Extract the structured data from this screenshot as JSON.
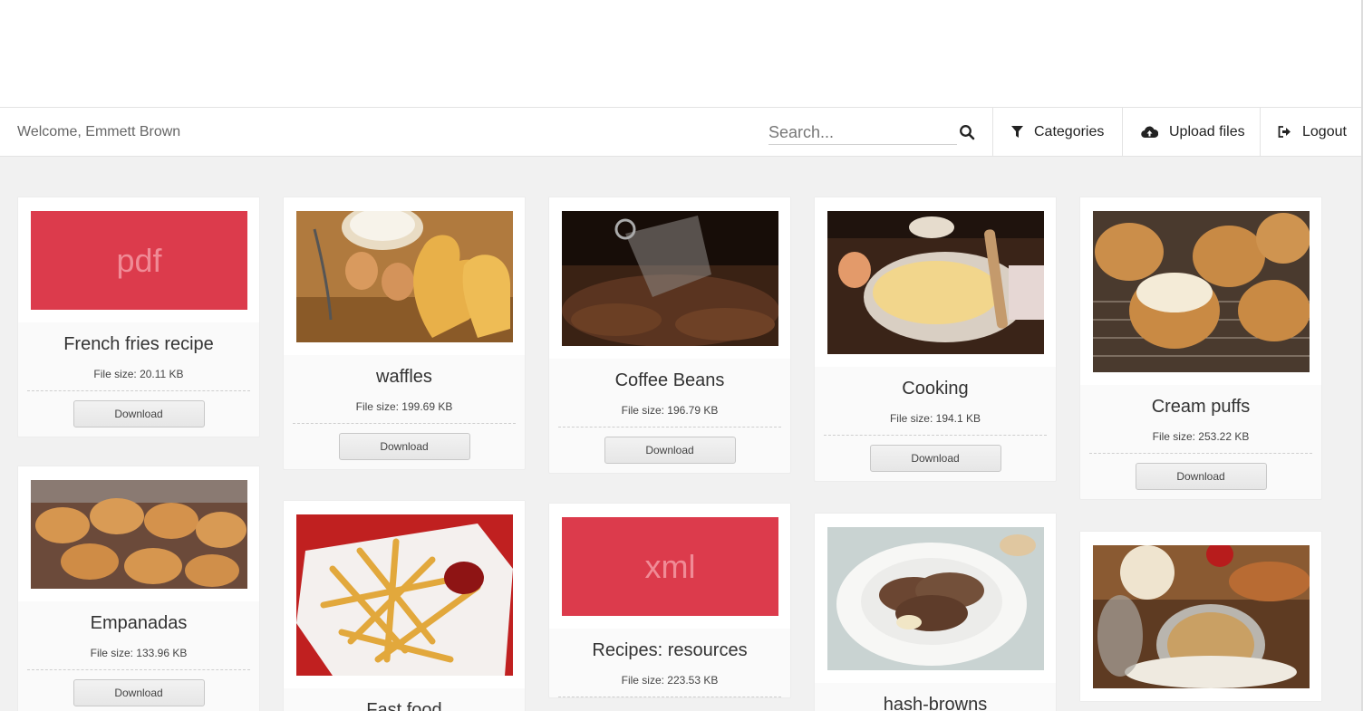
{
  "header": {
    "welcome": "Welcome, Emmett Brown",
    "search_placeholder": "Search...",
    "categories_label": "Categories",
    "upload_label": "Upload files",
    "logout_label": "Logout"
  },
  "cards": [
    {
      "title": "French fries recipe",
      "size": "File size: 20.11 KB",
      "thumb": "pdf",
      "download": "Download"
    },
    {
      "title": "waffles",
      "size": "File size: 199.69 KB",
      "thumb": "image: waffles with eggs and flour",
      "download": "Download"
    },
    {
      "title": "Coffee Beans",
      "size": "File size: 196.79 KB",
      "thumb": "image: coffee beans in glass cup",
      "download": "Download"
    },
    {
      "title": "Cooking",
      "size": "File size: 194.1 KB",
      "thumb": "image: dumplings on wooden table",
      "download": "Download"
    },
    {
      "title": "Cream puffs",
      "size": "File size: 253.22 KB",
      "thumb": "image: cream puffs on rack",
      "download": "Download"
    },
    {
      "title": "Empanadas",
      "size": "File size: 133.96 KB",
      "thumb": "image: baked empanadas on tray",
      "download": "Download"
    },
    {
      "title": "Fast food",
      "thumb": "image: french fries with ketchup"
    },
    {
      "title": "Recipes: resources",
      "size": "File size: 223.53 KB",
      "thumb": "xml"
    },
    {
      "title": "hash-browns",
      "thumb": "image: pancakes with chocolate on plate"
    },
    {
      "thumb": "image: granola jar with fruit"
    }
  ]
}
